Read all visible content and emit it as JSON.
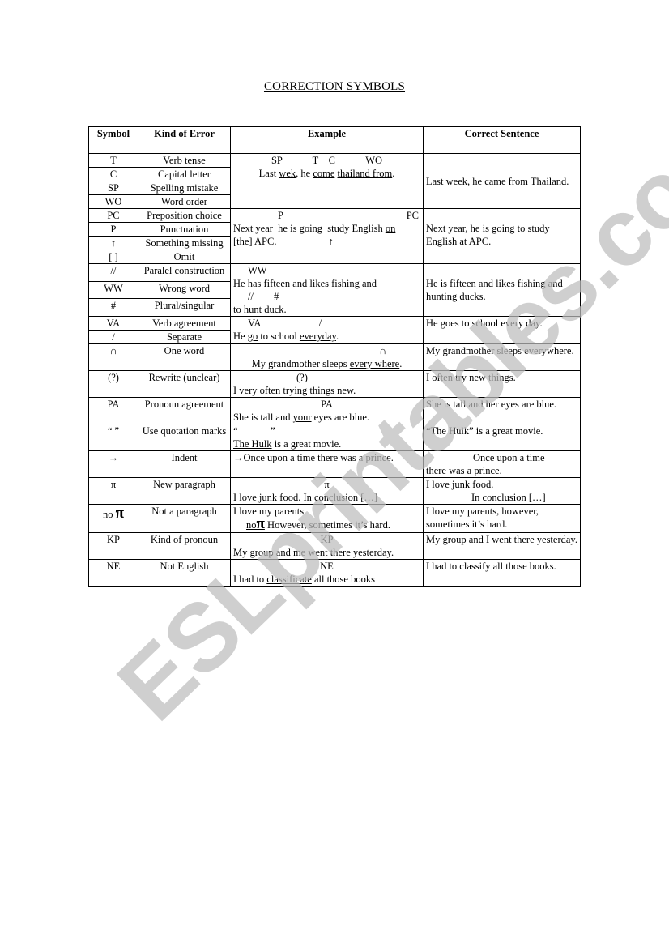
{
  "document": {
    "title": "CORRECTION SYMBOLS",
    "watermark": "ESLprintables.com"
  },
  "table": {
    "headers": [
      "Symbol",
      "Kind of Error",
      "Example",
      "Correct Sentence"
    ],
    "groups": [
      {
        "rows": [
          {
            "symbol": "T",
            "kind": "Verb tense"
          },
          {
            "symbol": "C",
            "kind": "Capital letter"
          },
          {
            "symbol": "SP",
            "kind": "Spelling mistake"
          },
          {
            "symbol": "WO",
            "kind": "Word order"
          }
        ],
        "example": {
          "marks": "SP            T    C            WO",
          "parts": [
            "Last ",
            "wek",
            ", he ",
            "come",
            " ",
            "thailand from",
            "."
          ]
        },
        "correct": "Last week, he came from Thailand."
      },
      {
        "rows": [
          {
            "symbol": "PC",
            "kind": "Preposition choice"
          },
          {
            "symbol": "P",
            "kind": "Punctuation"
          },
          {
            "symbol": "↑",
            "kind": "Something missing"
          },
          {
            "symbol": "[ ]",
            "kind": "Omit"
          }
        ],
        "example": {
          "marks_left": "P",
          "marks_right": "PC",
          "line1_parts": [
            "Next year  he is going  study English ",
            "on"
          ],
          "line2": "[the] APC.",
          "line2_mark": "↑"
        },
        "correct": "Next year, he is going to study English at APC."
      },
      {
        "rows": [
          {
            "symbol": "//",
            "kind": "Paralel construction"
          },
          {
            "symbol": "WW",
            "kind": "Wrong word"
          },
          {
            "symbol": "#",
            "kind": "Plural/singular"
          }
        ],
        "example": {
          "marks1": "WW",
          "line1_parts": [
            "He ",
            "has",
            " fifteen and likes fishing and"
          ],
          "marks2": "//        #",
          "line2_parts": [
            "to hunt",
            " ",
            "duck",
            "."
          ]
        },
        "correct": "He is fifteen and likes fishing and hunting ducks."
      },
      {
        "rows": [
          {
            "symbol": "VA",
            "kind": "Verb agreement"
          },
          {
            "symbol": "/",
            "kind": "Separate"
          }
        ],
        "example": {
          "marks": "VA                       /",
          "parts": [
            "He ",
            "go",
            " to school ",
            "everyday",
            "."
          ]
        },
        "correct": "He goes to school every day."
      },
      {
        "rows": [
          {
            "symbol": "∩",
            "kind": "One word"
          }
        ],
        "example": {
          "marks": "∩",
          "parts": [
            "My grandmother sleeps ",
            "every where",
            "."
          ]
        },
        "correct": "My grandmother sleeps everywhere."
      },
      {
        "rows": [
          {
            "symbol": "(?)",
            "kind": "Rewrite (unclear)"
          }
        ],
        "example": {
          "marks": "(?)",
          "text": "I very often trying things new."
        },
        "correct": "I often try new things."
      },
      {
        "rows": [
          {
            "symbol": "PA",
            "kind": "Pronoun agreement"
          }
        ],
        "example": {
          "marks": "PA",
          "parts": [
            "She is tall and ",
            "your",
            " eyes are blue."
          ]
        },
        "correct": "She is tall and her eyes are blue."
      },
      {
        "rows": [
          {
            "symbol": "“ ”",
            "kind": "Use quotation marks"
          }
        ],
        "example": {
          "marks": "“             ”",
          "parts": [
            "The Hulk",
            " is a great movie."
          ]
        },
        "correct": "“The Hulk” is a great movie."
      },
      {
        "rows": [
          {
            "symbol": "→",
            "kind": "Indent"
          }
        ],
        "example": {
          "text": "→Once upon a time there was a prince."
        },
        "correct_line1": "Once upon a time",
        "correct_line2": "there was a prince."
      },
      {
        "rows": [
          {
            "symbol": "π",
            "kind": "New paragraph"
          }
        ],
        "example": {
          "marks": "π",
          "text": "I love junk food. In conclusion […]"
        },
        "correct_line1": "I love junk food.",
        "correct_line2": "In conclusion […]"
      },
      {
        "rows": [
          {
            "symbol_prefix": "no ",
            "symbol_pi": "π",
            "kind": "Not a paragraph"
          }
        ],
        "example": {
          "line1": "I love my parents.",
          "mark_prefix": "no",
          "mark_pi": "π",
          "line2": " However, sometimes it’s hard."
        },
        "correct": "I love my parents, however, sometimes it’s hard."
      },
      {
        "rows": [
          {
            "symbol": "KP",
            "kind": "Kind of pronoun"
          }
        ],
        "example": {
          "marks": "KP",
          "parts": [
            "My group and ",
            "me",
            " went there yesterday."
          ]
        },
        "correct": "My group and I went there yesterday."
      },
      {
        "rows": [
          {
            "symbol": "NE",
            "kind": "Not English"
          }
        ],
        "example": {
          "marks": "NE",
          "parts": [
            "I had to ",
            "classificate",
            " all those books"
          ]
        },
        "correct": "I had to classify all those books."
      }
    ]
  }
}
